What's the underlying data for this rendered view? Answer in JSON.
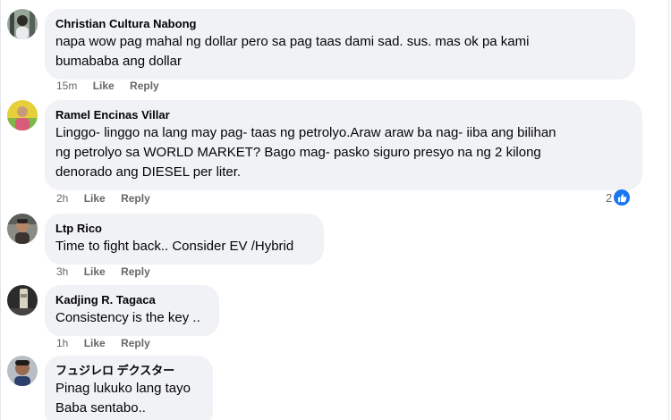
{
  "comments": [
    {
      "author": "Christian Cultura Nabong",
      "lines": [
        "napa wow pag mahal ng dollar pero sa pag taas dami sad. sus. mas ok pa kami",
        "bumababa ang dollar"
      ],
      "time": "15m",
      "like_label": "Like",
      "reply_label": "Reply",
      "avatar_icon": "user-avatar-photo"
    },
    {
      "author": "Ramel Encinas Villar",
      "lines": [
        "Linggo- linggo na lang may pag- taas ng petrolyo.Araw araw ba nag- iiba ang bilihan",
        "ng petrolyo sa WORLD MARKET? Bago mag- pasko siguro presyo na ng 2 kilong",
        "denorado ang DIESEL per liter."
      ],
      "time": "2h",
      "like_label": "Like",
      "reply_label": "Reply",
      "reaction_count": "2",
      "reaction_icon": "like-reaction-icon",
      "avatar_icon": "user-avatar-photo"
    },
    {
      "author": "Ltp Rico",
      "lines": [
        "Time to fight back.. Consider EV /Hybrid"
      ],
      "time": "3h",
      "like_label": "Like",
      "reply_label": "Reply",
      "avatar_icon": "user-avatar-photo"
    },
    {
      "author": "Kadjing R. Tagaca",
      "lines": [
        "Consistency is the key .."
      ],
      "time": "1h",
      "like_label": "Like",
      "reply_label": "Reply",
      "avatar_icon": "user-avatar-photo"
    },
    {
      "author": "フュジレロ デクスター",
      "lines": [
        "Pinag lukuko lang tayo",
        "Baba sentabo.."
      ],
      "avatar_icon": "user-avatar-photo"
    }
  ],
  "colors": {
    "bubble": "#f0f2f5",
    "meta": "#65676b",
    "like_badge": "#1877f2"
  }
}
